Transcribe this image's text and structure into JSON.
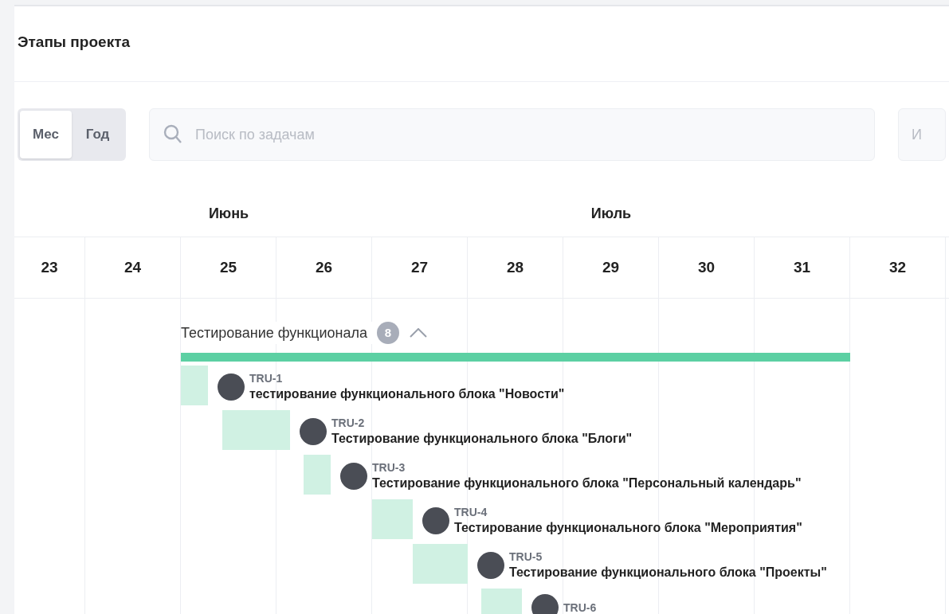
{
  "page": {
    "title": "Этапы проекта"
  },
  "view_toggle": [
    {
      "label": "Мес",
      "selected": true
    },
    {
      "label": "Год",
      "selected": false
    }
  ],
  "search": {
    "placeholder": "Поиск по задачам"
  },
  "filter_field": {
    "placeholder": "И"
  },
  "months": [
    {
      "label": "Июнь"
    },
    {
      "label": "Июль"
    }
  ],
  "weeks": [
    "23",
    "24",
    "25",
    "26",
    "27",
    "28",
    "29",
    "30",
    "31",
    "32"
  ],
  "group": {
    "title": "Тестирование функционала",
    "count": "8",
    "expanded": true
  },
  "tasks": [
    {
      "id": "TRU-1",
      "title": "тестирование функционального блока \"Новости\""
    },
    {
      "id": "TRU-2",
      "title": "Тестирование функционального блока \"Блоги\""
    },
    {
      "id": "TRU-3",
      "title": "Тестирование функционального блока \"Персональный календарь\""
    },
    {
      "id": "TRU-4",
      "title": "Тестирование функционального блока \"Мероприятия\""
    },
    {
      "id": "TRU-5",
      "title": "Тестирование функционального блока \"Проекты\""
    },
    {
      "id": "TRU-6"
    }
  ]
}
